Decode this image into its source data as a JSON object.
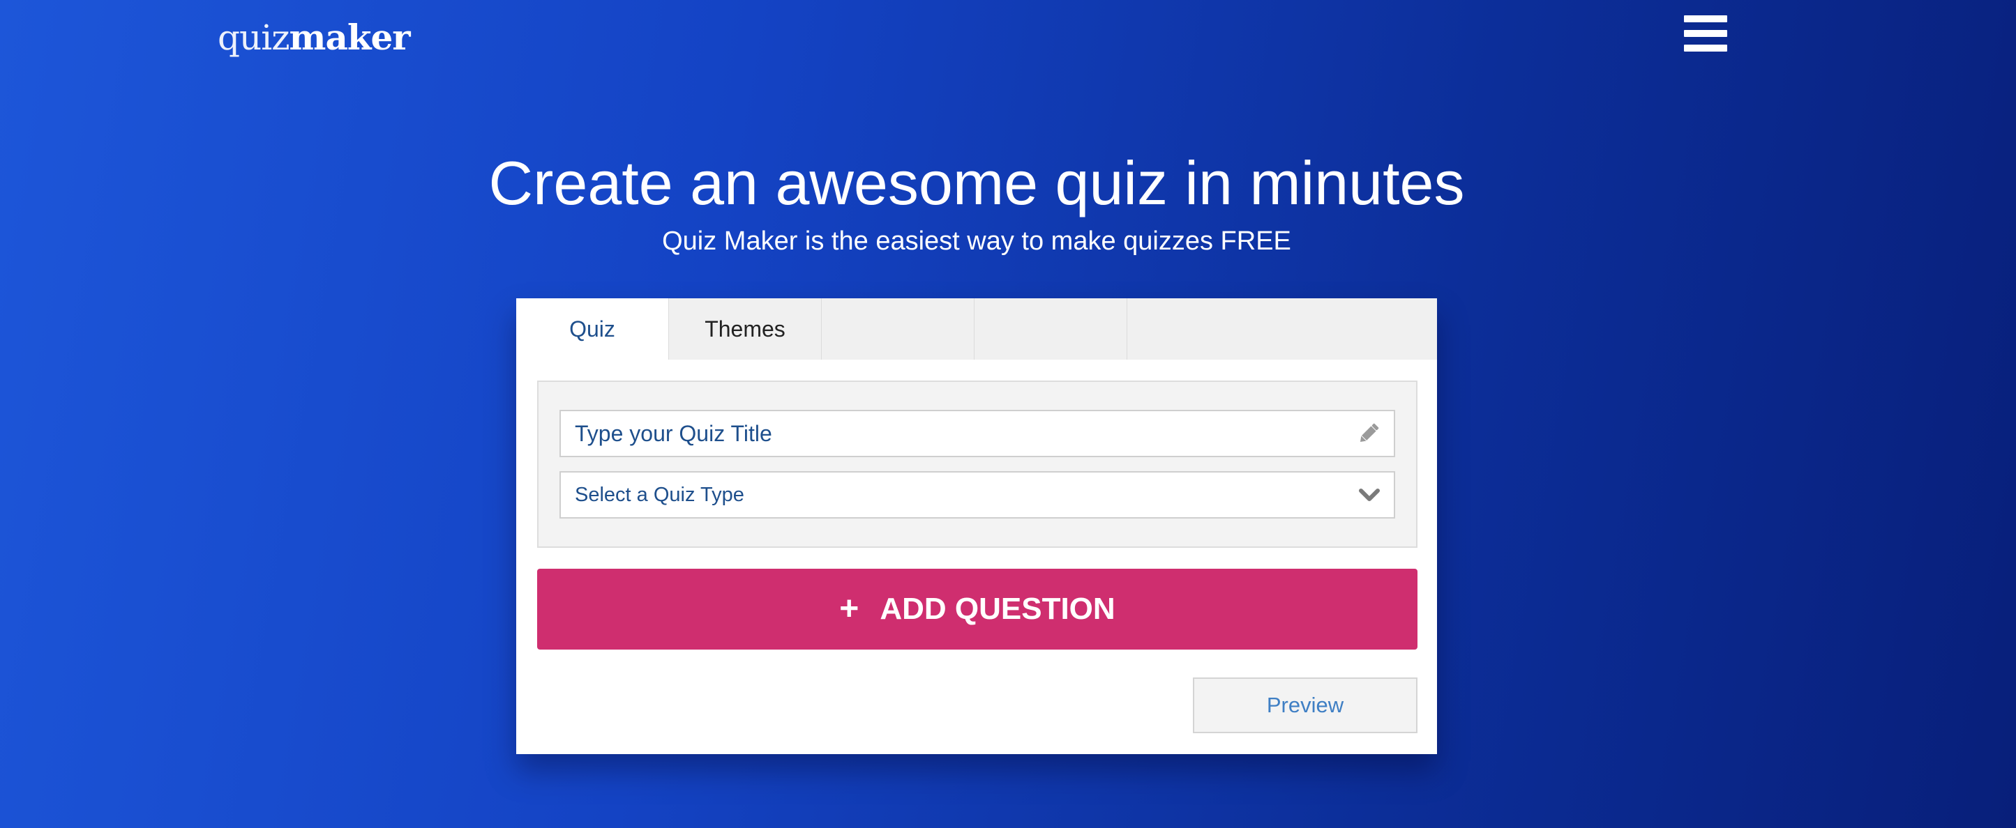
{
  "header": {
    "logo_light": "quiz",
    "logo_bold": "maker",
    "menu_icon": "hamburger-menu-icon"
  },
  "hero": {
    "title": "Create an awesome quiz in minutes",
    "subtitle": "Quiz Maker is the easiest way to make quizzes FREE"
  },
  "tabs": [
    {
      "label": "Quiz",
      "active": true
    },
    {
      "label": "Themes",
      "active": false
    },
    {
      "label": "",
      "active": false
    },
    {
      "label": "",
      "active": false
    },
    {
      "label": "",
      "active": false
    }
  ],
  "form": {
    "title_placeholder": "Type your Quiz Title",
    "title_value": "",
    "title_icon": "pencil-icon",
    "type_selected": "Select a Quiz Type",
    "type_icon": "chevron-down-icon"
  },
  "actions": {
    "add_question_icon": "+",
    "add_question_label": "ADD QUESTION",
    "preview_label": "Preview"
  },
  "colors": {
    "background_start": "#1d56d9",
    "background_end": "#081f7a",
    "accent_button": "#cf2e6f",
    "link_text": "#1e4f8c",
    "preview_text": "#3f7fc4"
  }
}
